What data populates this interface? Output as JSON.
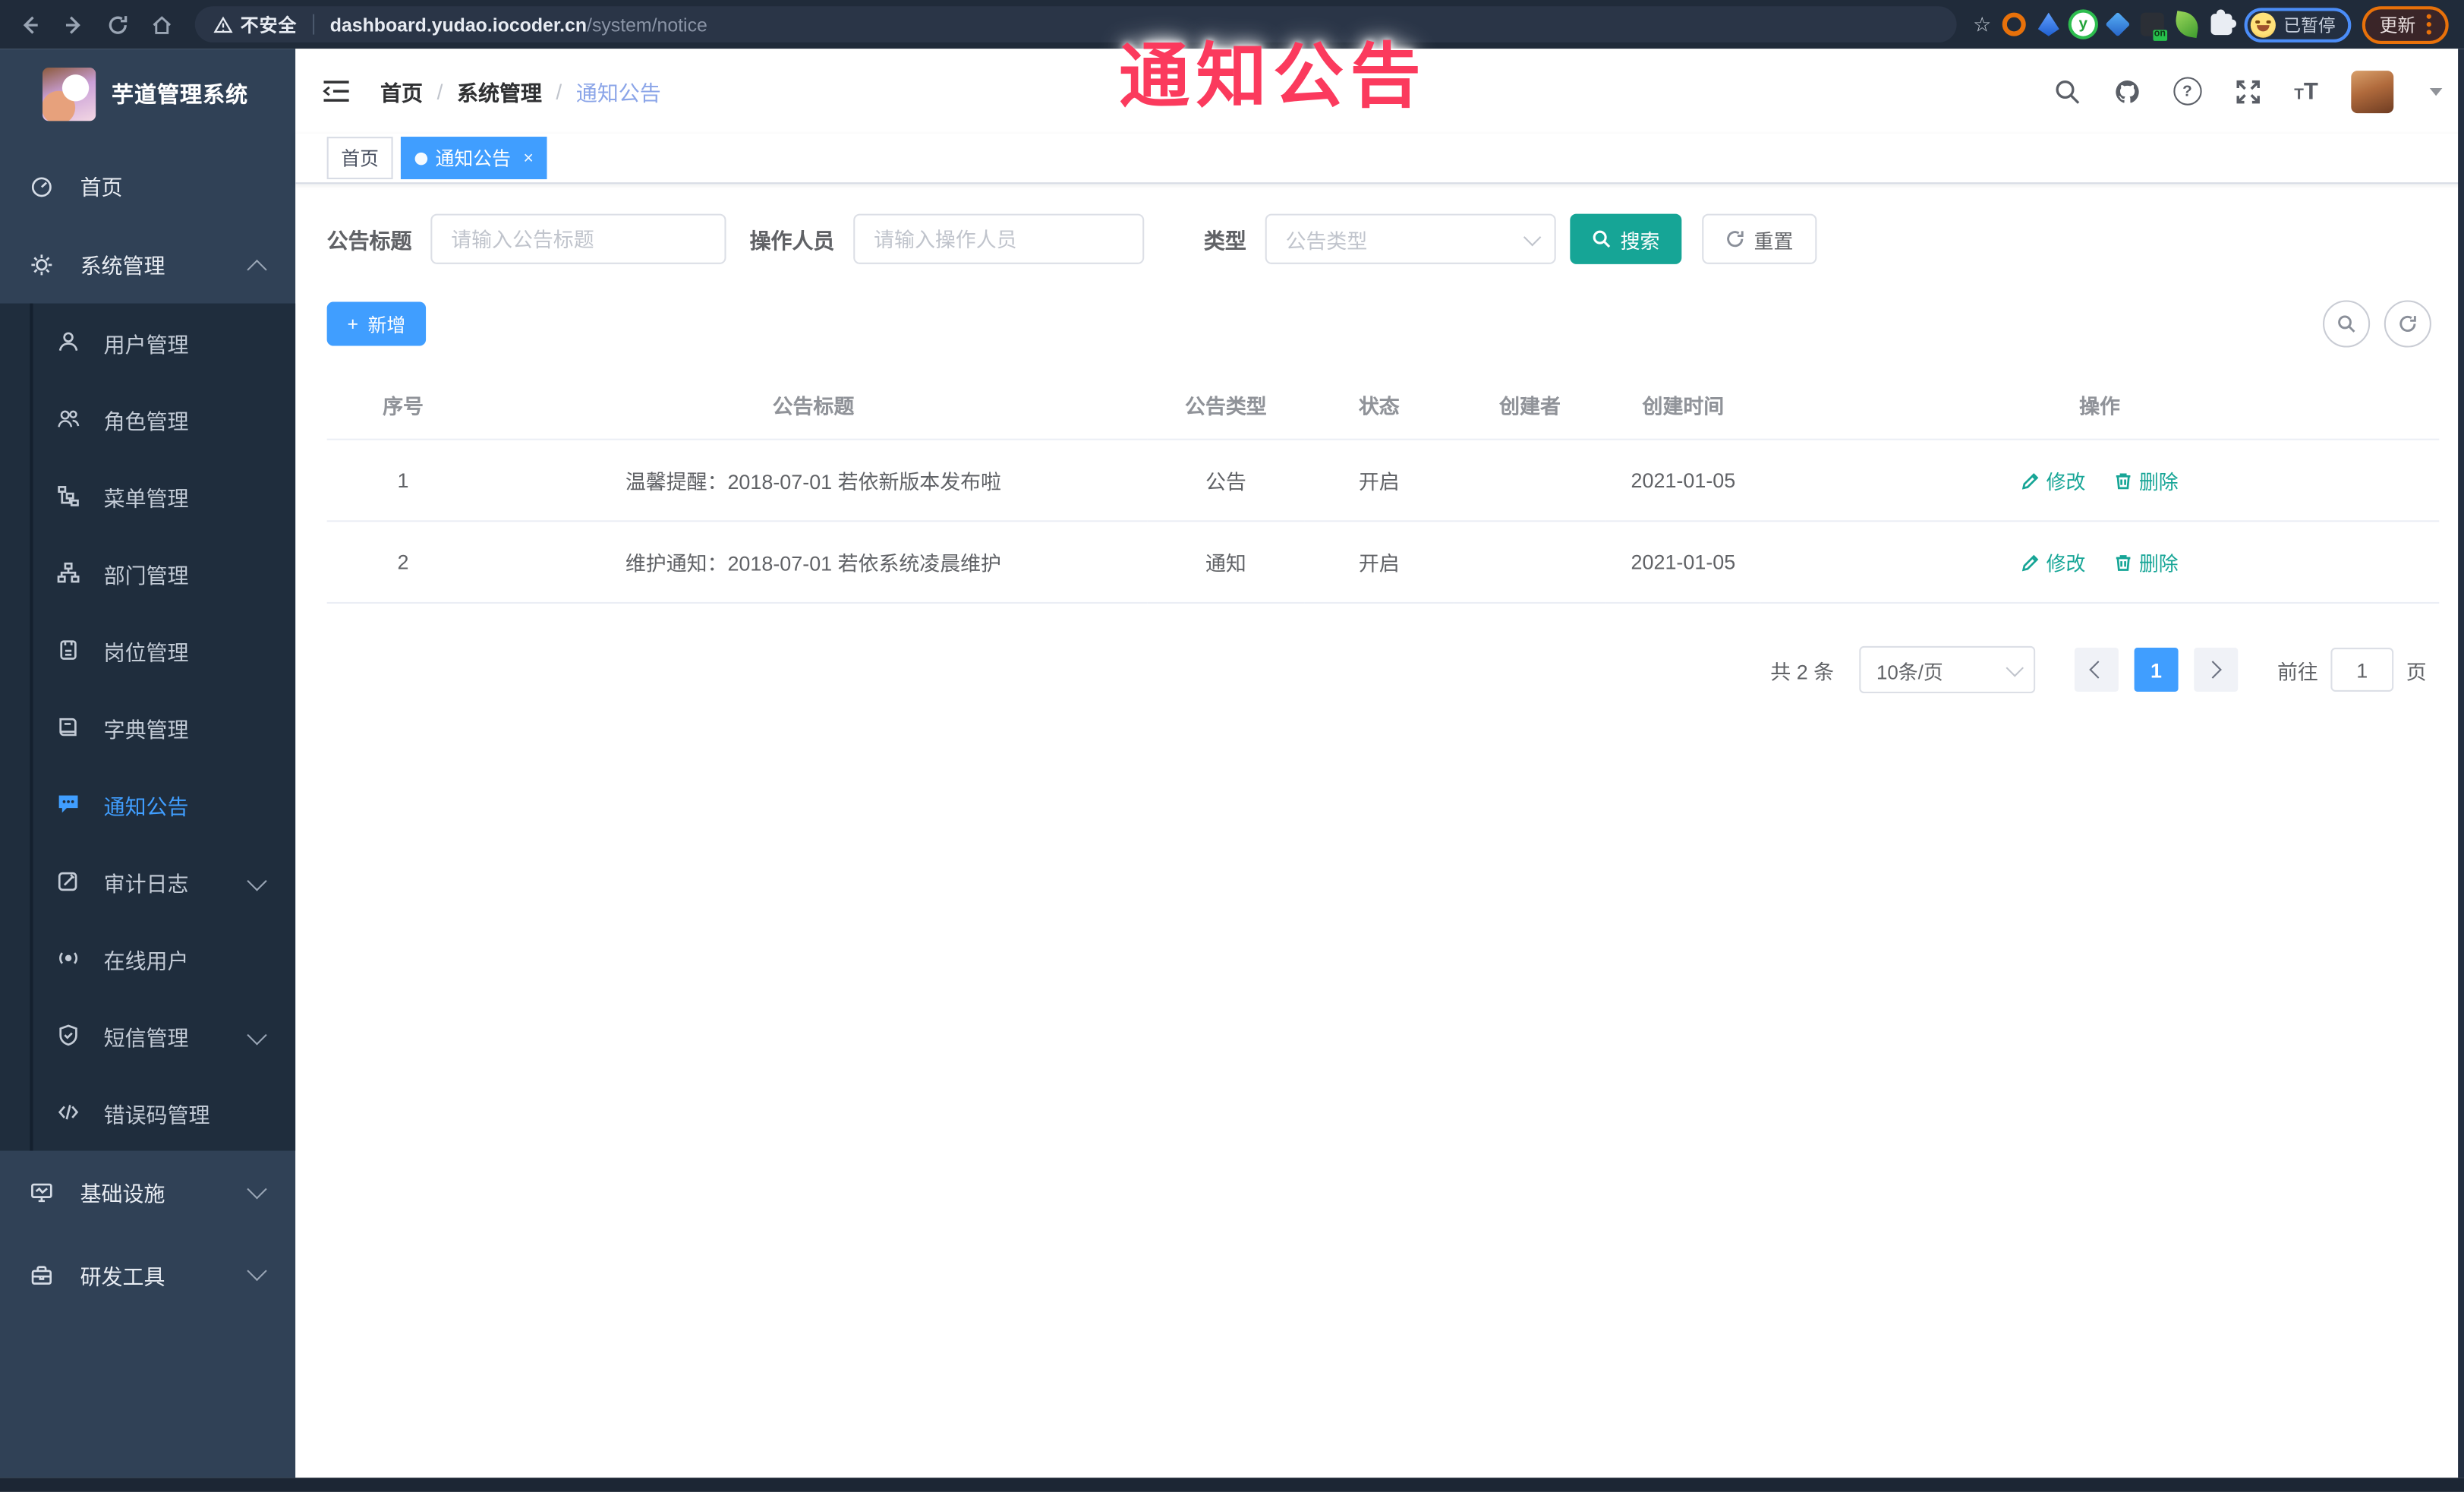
{
  "browser": {
    "security_label": "不安全",
    "url_host": "dashboard.yudao.iocoder.cn",
    "url_path": "/system/notice",
    "profile_chip": "已暂停",
    "update_button": "更新"
  },
  "overlay": {
    "text": "通知公告"
  },
  "colors": {
    "primary": "#409EFF",
    "search_button": "#16a596",
    "overlay_text": "#fb3a5d",
    "sidebar_bg": "#304156",
    "submenu_bg": "#1f2d3d",
    "chrome_bg": "#202b3a"
  },
  "sidebar": {
    "logo_title": "芋道管理系统",
    "home": "首页",
    "system": "系统管理",
    "infra": "基础设施",
    "dev": "研发工具",
    "sub": [
      "用户管理",
      "角色管理",
      "菜单管理",
      "部门管理",
      "岗位管理",
      "字典管理",
      "通知公告",
      "审计日志",
      "在线用户",
      "短信管理",
      "错误码管理"
    ]
  },
  "header": {
    "breadcrumb": [
      "首页",
      "系统管理",
      "通知公告"
    ],
    "separator": "/"
  },
  "tabs": {
    "home": "首页",
    "current": "通知公告",
    "close": "×"
  },
  "filters": {
    "title_label": "公告标题",
    "title_placeholder": "请输入公告标题",
    "operator_label": "操作人员",
    "operator_placeholder": "请输入操作人员",
    "type_label": "类型",
    "type_placeholder": "公告类型",
    "search_label": "搜索",
    "reset_label": "重置"
  },
  "toolbar": {
    "add_icon": "+",
    "add_label": "新增"
  },
  "table": {
    "columns": [
      "序号",
      "公告标题",
      "公告类型",
      "状态",
      "创建者",
      "创建时间",
      "操作"
    ],
    "edit_label": "修改",
    "delete_label": "删除",
    "rows": [
      {
        "no": "1",
        "title": "温馨提醒：2018-07-01 若依新版本发布啦",
        "type": "公告",
        "status": "开启",
        "creator": "",
        "time": "2021-01-05"
      },
      {
        "no": "2",
        "title": "维护通知：2018-07-01 若依系统凌晨维护",
        "type": "通知",
        "status": "开启",
        "creator": "",
        "time": "2021-01-05"
      }
    ]
  },
  "pagination": {
    "total": "共 2 条",
    "page_size": "10条/页",
    "current_page": "1",
    "goto_label": "前往",
    "goto_value": "1",
    "page_unit": "页"
  }
}
